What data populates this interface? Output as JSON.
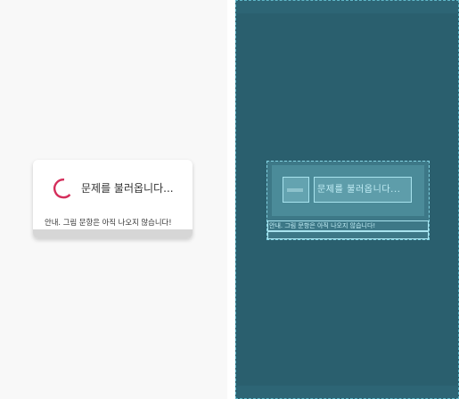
{
  "dialog": {
    "title": "문제를 불러옵니다...",
    "note": "안내. 그림 문항은 아직 나오지 않습니다!"
  },
  "blueprint": {
    "title": "문제를 불러옵니다...",
    "note": "안내. 그림 문항은 아직 나오지 않습니다!"
  },
  "colors": {
    "spinner": "#d42e5b",
    "blueprint_background": "#2a5f6e",
    "blueprint_outline": "#84d4e3"
  }
}
